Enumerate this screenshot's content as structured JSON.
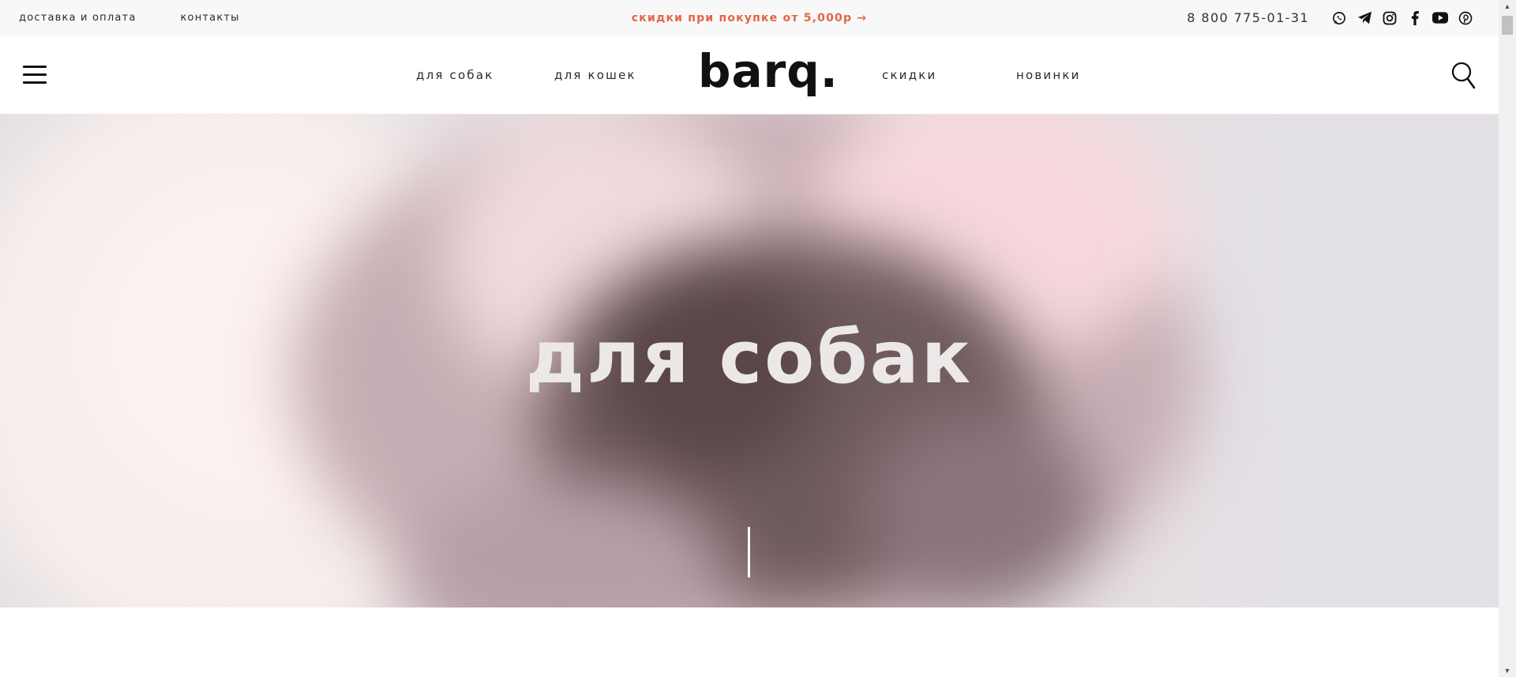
{
  "topbar": {
    "links": [
      "доставка и оплата",
      "контакты"
    ],
    "promo": "скидки при покупке от 5,000р →",
    "phone": "8 800 775-01-31",
    "socials": [
      "whatsapp-icon",
      "telegram-icon",
      "instagram-icon",
      "facebook-icon",
      "youtube-icon",
      "pinterest-icon"
    ]
  },
  "header": {
    "logo": "barq.",
    "nav": [
      "для собак",
      "для кошек",
      "скидки",
      "новинки"
    ]
  },
  "hero": {
    "title": "для собак"
  },
  "colors": {
    "promo": "#e4644a",
    "topbar_bg": "#f8f8f8",
    "hero_text": "#ece8e8"
  }
}
